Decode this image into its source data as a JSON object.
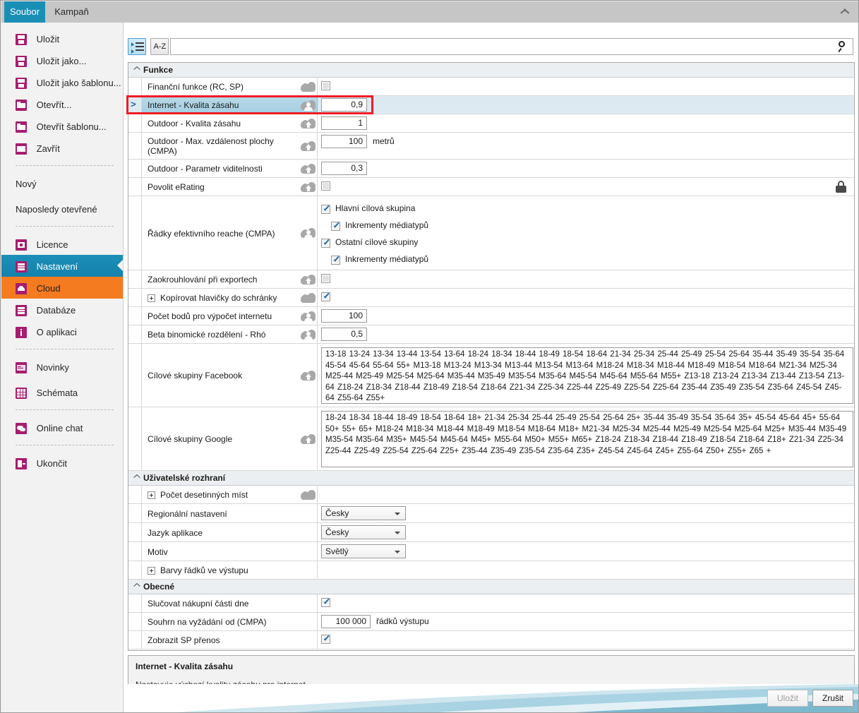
{
  "window": {
    "ribbon_tabs": [
      {
        "label": "Soubor",
        "active": true
      },
      {
        "label": "Kampaň",
        "active": false
      }
    ],
    "collapse_icon": "chevron-up-icon"
  },
  "backstage": {
    "items": [
      {
        "label": "Uložit",
        "icon": "save-icon",
        "type": "item"
      },
      {
        "label": "Uložit jako...",
        "icon": "save-as-icon",
        "type": "item"
      },
      {
        "label": "Uložit jako šablonu...",
        "icon": "save-as-template-icon",
        "type": "item"
      },
      {
        "label": "Otevřít...",
        "icon": "open-folder-icon",
        "type": "item"
      },
      {
        "label": "Otevřít šablonu...",
        "icon": "open-template-icon",
        "type": "item"
      },
      {
        "label": "Zavřít",
        "icon": "close-folder-icon",
        "type": "item"
      },
      {
        "type": "separator"
      },
      {
        "label": "Nový",
        "icon": null,
        "type": "item"
      },
      {
        "label": "Naposledy otevřené",
        "icon": null,
        "type": "item"
      },
      {
        "type": "separator"
      },
      {
        "label": "Licence",
        "icon": "license-card-icon",
        "type": "item"
      },
      {
        "label": "Nastavení",
        "icon": "settings-server-icon",
        "type": "item",
        "state": "selected-blue"
      },
      {
        "label": "Cloud",
        "icon": "cloud-icon",
        "type": "item",
        "state": "selected-orange"
      },
      {
        "label": "Databáze",
        "icon": "database-icon",
        "type": "item"
      },
      {
        "label": "O aplikaci",
        "icon": "info-icon",
        "type": "item"
      },
      {
        "type": "separator"
      },
      {
        "label": "Novinky",
        "icon": "news-icon",
        "type": "item"
      },
      {
        "label": "Schémata",
        "icon": "grid-icon",
        "type": "item"
      },
      {
        "type": "separator"
      },
      {
        "label": "Online chat",
        "icon": "chat-icon",
        "type": "item"
      },
      {
        "type": "separator"
      },
      {
        "label": "Ukončit",
        "icon": "exit-icon",
        "type": "item"
      }
    ]
  },
  "toolbar": {
    "categorized_button": {
      "label": "",
      "icon": "categorized-view-icon",
      "active": true
    },
    "alphabetical_button": {
      "label": "A-Z",
      "icon": "alphabetical-sort-icon",
      "active": false
    },
    "search": {
      "value": "",
      "placeholder": "",
      "icon": "search-icon"
    }
  },
  "grid": {
    "categories": [
      {
        "name": "Funkce",
        "collapse_icon": "chevron-up-icon",
        "rows": [
          {
            "label": "Finanční funkce (RC, SP)",
            "cloud": "cloud-plain-icon",
            "editor": "checkbox",
            "checked": false,
            "disabled": true
          },
          {
            "label": "Internet - Kvalita zásahu",
            "cloud": "cloud-person-icon",
            "editor": "number",
            "value": "0,9",
            "selected": true,
            "row_marker": ">"
          },
          {
            "label": "Outdoor - Kvalita zásahu",
            "cloud": "cloud-upload-icon",
            "editor": "number",
            "value": "1"
          },
          {
            "label": "Outdoor - Max. vzdálenost plochy (CMPA)",
            "cloud": "cloud-upload-icon",
            "editor": "number",
            "value": "100",
            "unit": "metrů"
          },
          {
            "label": "Outdoor - Parametr viditelnosti",
            "cloud": "cloud-upload-icon",
            "editor": "number",
            "value": "0,3"
          },
          {
            "label": "Povolit eRating",
            "cloud": "cloud-upload-icon",
            "editor": "checkbox",
            "checked": false,
            "disabled": true,
            "lock_icon": "lock-icon"
          },
          {
            "label": "Řádky efektivního reache (CMPA)",
            "cloud": "cloud-person-icon",
            "editor": "checkbox-group",
            "options": [
              {
                "label": "Hlavní cílová skupina",
                "checked": true,
                "indent": false
              },
              {
                "label": "Inkrementy médiatypů",
                "checked": true,
                "indent": true
              },
              {
                "label": "Ostatní cílové skupiny",
                "checked": true,
                "indent": false
              },
              {
                "label": "Inkrementy médiatypů",
                "checked": true,
                "indent": true
              }
            ]
          },
          {
            "label": "Zaokrouhlování při exportech",
            "cloud": "cloud-upload-icon",
            "editor": "checkbox",
            "checked": false,
            "disabled": true
          },
          {
            "label": "Kopírovat hlavičky do schránky",
            "cloud": "cloud-plain-icon",
            "editor": "checkbox",
            "checked": true,
            "expandable": true
          },
          {
            "label": "Počet bodů pro výpočet internetu",
            "cloud": "cloud-person-icon",
            "editor": "number",
            "value": "100"
          },
          {
            "label": "Beta binomické rozdělení - Rhó",
            "cloud": "cloud-person-icon",
            "editor": "number",
            "value": "0,5"
          },
          {
            "label": "Cílové skupiny Facebook",
            "cloud": "cloud-upload-icon",
            "editor": "listbox",
            "value": "13-18 13-24 13-34 13-44 13-54 13-64 18-24 18-34 18-44 18-49 18-54 18-64 21-34 25-34 25-44 25-49 25-54 25-64 35-44 35-49 35-54 35-64 45-54 45-64 55-64 55+ M13-18 M13-24 M13-34 M13-44 M13-54 M13-64 M18-24 M18-34 M18-44 M18-49 M18-54 M18-64 M21-34 M25-34 M25-44 M25-49 M25-54 M25-64 M35-44 M35-49 M35-54 M35-64 M45-54 M45-64 M55-64 M55+ Z13-18 Z13-24 Z13-34 Z13-44 Z13-54 Z13-64 Z18-24 Z18-34 Z18-44 Z18-49 Z18-54 Z18-64 Z21-34 Z25-34 Z25-44 Z25-49 Z25-54 Z25-64 Z35-44 Z35-49 Z35-54 Z35-64 Z45-54 Z45-64 Z55-64 Z55+"
          },
          {
            "label": "Cílové skupiny Google",
            "cloud": "cloud-upload-icon",
            "editor": "listbox",
            "value": "18-24 18-34 18-44 18-49 18-54 18-64 18+ 21-34 25-34 25-44 25-49 25-54 25-64 25+ 35-44 35-49 35-54 35-64 35+ 45-54 45-64 45+ 55-64 50+ 55+ 65+ M18-24 M18-34 M18-44 M18-49 M18-54 M18-64 M18+ M21-34 M25-34 M25-44 M25-49 M25-54 M25-64 M25+ M35-44 M35-49 M35-54 M35-64 M35+ M45-54 M45-64 M45+ M55-64 M50+ M55+ M65+ Z18-24 Z18-34 Z18-44 Z18-49 Z18-54 Z18-64 Z18+ Z21-34 Z25-34 Z25-44 Z25-49 Z25-54 Z25-64 Z25+ Z35-44 Z35-49 Z35-54 Z35-64 Z35+ Z45-54 Z45-64 Z45+ Z55-64 Z50+ Z55+ Z65 +"
          }
        ]
      },
      {
        "name": "Uživatelské rozhraní",
        "collapse_icon": "chevron-up-icon",
        "rows": [
          {
            "label": "Počet desetinných míst",
            "cloud": "cloud-plain-icon",
            "editor": "none",
            "expandable": true
          },
          {
            "label": "Regionální nastavení",
            "cloud": null,
            "editor": "combo",
            "value": "Česky"
          },
          {
            "label": "Jazyk aplikace",
            "cloud": null,
            "editor": "combo",
            "value": "Česky"
          },
          {
            "label": "Motiv",
            "cloud": null,
            "editor": "combo",
            "value": "Světlý"
          },
          {
            "label": "Barvy řádků ve výstupu",
            "cloud": null,
            "editor": "none",
            "expandable": true
          }
        ]
      },
      {
        "name": "Obecné",
        "collapse_icon": "chevron-up-icon",
        "rows": [
          {
            "label": "Slučovat nákupní části dne",
            "cloud": null,
            "editor": "checkbox",
            "checked": true
          },
          {
            "label": "Souhrn na vyžádání od (CMPA)",
            "cloud": null,
            "editor": "number",
            "value": "100 000",
            "unit": "řádků výstupu"
          },
          {
            "label": "Zobrazit SP přenos",
            "cloud": null,
            "editor": "checkbox",
            "checked": true
          }
        ]
      }
    ]
  },
  "description": {
    "title": "Internet - Kvalita zásahu",
    "text": "Nastavuje výchozí kvalitu zásahu pro internet."
  },
  "footer": {
    "save_label": "Uložit",
    "cancel_label": "Zrušit"
  },
  "colors": {
    "accent_blue": "#1a8fb5",
    "accent_orange": "#f47b20",
    "icon_magenta": "#a61d6e",
    "annotation_red": "#ee1c25",
    "selection_blue": "#b8d9e8"
  }
}
